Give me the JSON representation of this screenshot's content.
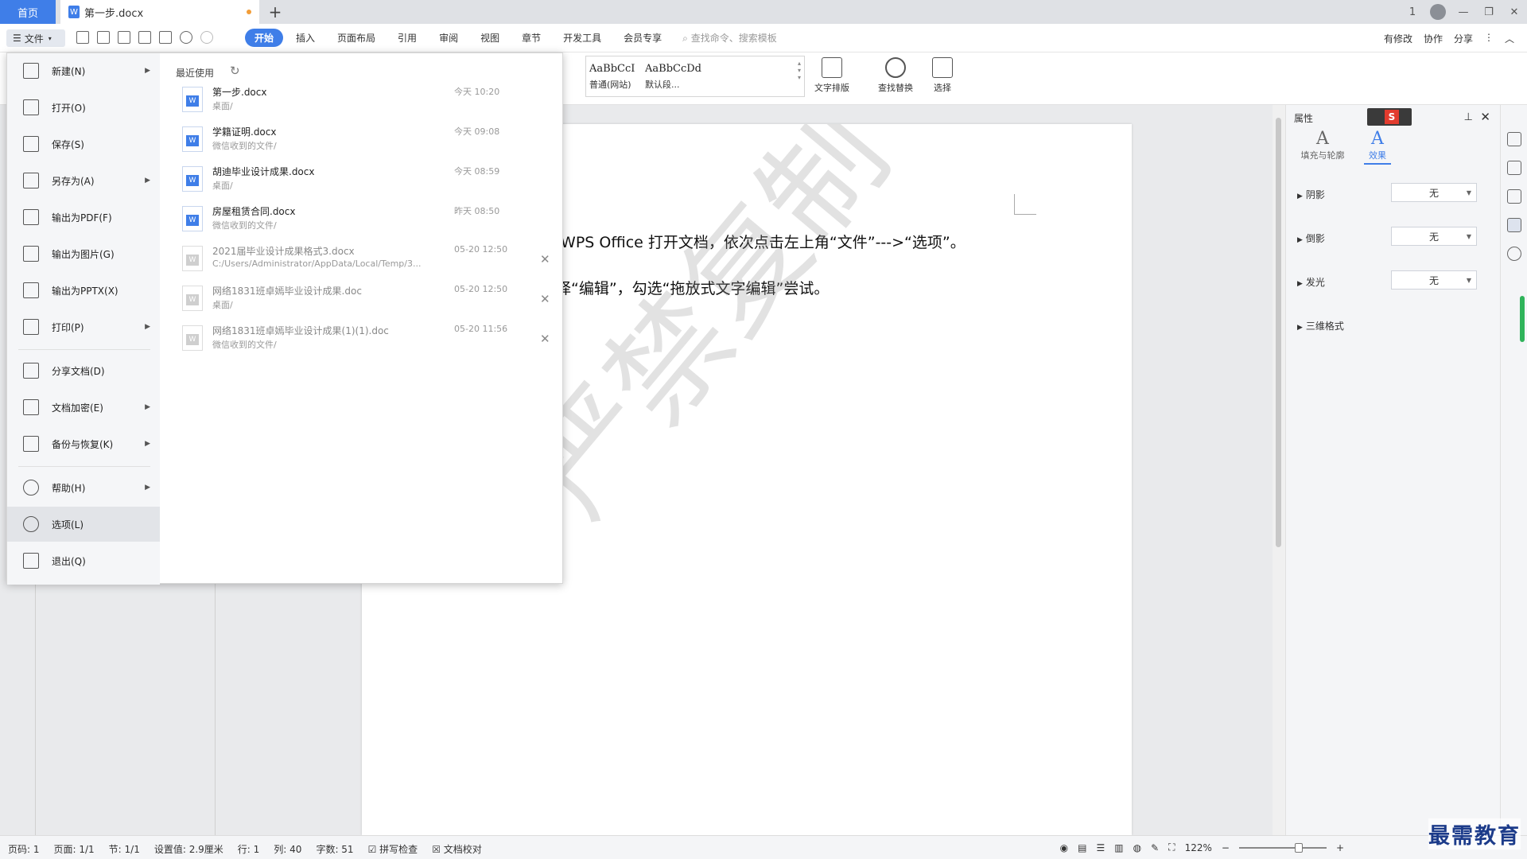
{
  "titlebar": {
    "home_tab": "首页",
    "doc_tab": "第一步.docx",
    "doc_icon_letter": "W",
    "add_tab": "+",
    "window_controls": [
      "1",
      "—",
      "❐",
      "✕"
    ]
  },
  "menubar": {
    "file_label": "文件",
    "tabs": [
      "开始",
      "插入",
      "页面布局",
      "引用",
      "审阅",
      "视图",
      "章节",
      "开发工具",
      "会员专享"
    ],
    "active_tab": "开始",
    "search_placeholder": "查找命令、搜索模板",
    "right_links": [
      "有修改",
      "协作",
      "分享"
    ]
  },
  "ribbon": {
    "styles": [
      {
        "sample": "AaBbCcI",
        "name": "普通(网站)"
      },
      {
        "sample": "AaBbCcDd",
        "name": "默认段..."
      }
    ],
    "buttons": [
      "文字排版",
      "查找替换",
      "选择"
    ]
  },
  "document": {
    "line1": "用 WPS Office 打开文档，依次点击左上角“文件”--->“选项”。",
    "line2": "选择“编辑”，勾选“拖放式文字编辑”尝试。",
    "watermark": "严禁复制"
  },
  "file_menu": {
    "items": [
      {
        "label": "新建(N)",
        "arrow": true
      },
      {
        "label": "打开(O)",
        "arrow": false
      },
      {
        "label": "保存(S)",
        "arrow": false
      },
      {
        "label": "另存为(A)",
        "arrow": true
      },
      {
        "label": "输出为PDF(F)",
        "arrow": false
      },
      {
        "label": "输出为图片(G)",
        "arrow": false
      },
      {
        "label": "输出为PPTX(X)",
        "arrow": false
      },
      {
        "label": "打印(P)",
        "arrow": true
      },
      {
        "label": "分享文档(D)",
        "arrow": false
      },
      {
        "label": "文档加密(E)",
        "arrow": true
      },
      {
        "label": "备份与恢复(K)",
        "arrow": true
      },
      {
        "label": "帮助(H)",
        "arrow": true
      },
      {
        "label": "选项(L)",
        "arrow": false
      },
      {
        "label": "退出(Q)",
        "arrow": false
      }
    ],
    "active_item": "选项(L)",
    "recent_title": "最近使用",
    "recent_files": [
      {
        "name": "第一步.docx",
        "path": "桌面/",
        "time": "今天 10:20",
        "dim": false
      },
      {
        "name": "学籍证明.docx",
        "path": "微信收到的文件/",
        "time": "今天 09:08",
        "dim": false
      },
      {
        "name": "胡迪毕业设计成果.docx",
        "path": "桌面/",
        "time": "今天 08:59",
        "dim": false
      },
      {
        "name": "房屋租赁合同.docx",
        "path": "微信收到的文件/",
        "time": "昨天 08:50",
        "dim": false
      },
      {
        "name": "2021届毕业设计成果格式3.docx",
        "path": "C:/Users/Administrator/AppData/Local/Temp/3...",
        "time": "05-20 12:50",
        "dim": true
      },
      {
        "name": "网络1831班卓嫣毕业设计成果.doc",
        "path": "桌面/",
        "time": "05-20 12:50",
        "dim": true
      },
      {
        "name": "网络1831班卓嫣毕业设计成果(1)(1).doc",
        "path": "微信收到的文件/",
        "time": "05-20 11:56",
        "dim": true
      }
    ]
  },
  "properties_panel": {
    "title": "属性",
    "tabs": [
      "填充与轮廓",
      "效果"
    ],
    "active_tab": "效果",
    "rows": [
      {
        "label": "阴影",
        "value": "无"
      },
      {
        "label": "倒影",
        "value": "无"
      },
      {
        "label": "发光",
        "value": "无"
      },
      {
        "label": "三维格式",
        "value": ""
      }
    ]
  },
  "statusbar": {
    "items": [
      "页码: 1",
      "页面: 1/1",
      "节: 1/1",
      "设置值: 2.9厘米",
      "行: 1",
      "列: 40",
      "字数: 51",
      "拼写检查",
      "文档校对"
    ],
    "zoom": "122%",
    "brand": "最需教育"
  },
  "colors": {
    "accent": "#3f7ee8",
    "watermark": "#969696",
    "brand": "#1c3b8a"
  }
}
